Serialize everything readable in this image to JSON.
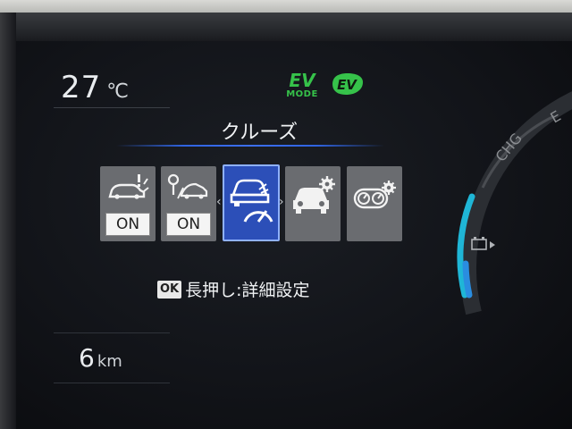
{
  "status": {
    "temperature_value": "27",
    "temperature_unit": "℃",
    "ev_mode_ev": "EV",
    "ev_mode_mode": "MODE",
    "ev_badge": "EV",
    "distance_value": "6",
    "distance_unit": "km"
  },
  "menu": {
    "title": "クルーズ",
    "tiles": [
      {
        "icon": "pre-collision-car-icon",
        "state": "ON"
      },
      {
        "icon": "lane-departure-car-icon",
        "state": "ON"
      },
      {
        "icon": "cruise-speedometer-icon",
        "selected": true
      },
      {
        "icon": "car-settings-icon"
      },
      {
        "icon": "meter-settings-icon"
      }
    ],
    "hint_key": "OK",
    "hint_text": "長押し:詳細設定"
  },
  "gauge": {
    "label_chg": "CHG",
    "label_e": "E",
    "accent_color": "#1fb6d6",
    "level": 0.7
  },
  "colors": {
    "ev_green": "#36c24a",
    "selected_tile": "#2c4fb8",
    "title_line": "#3c6ff0"
  }
}
